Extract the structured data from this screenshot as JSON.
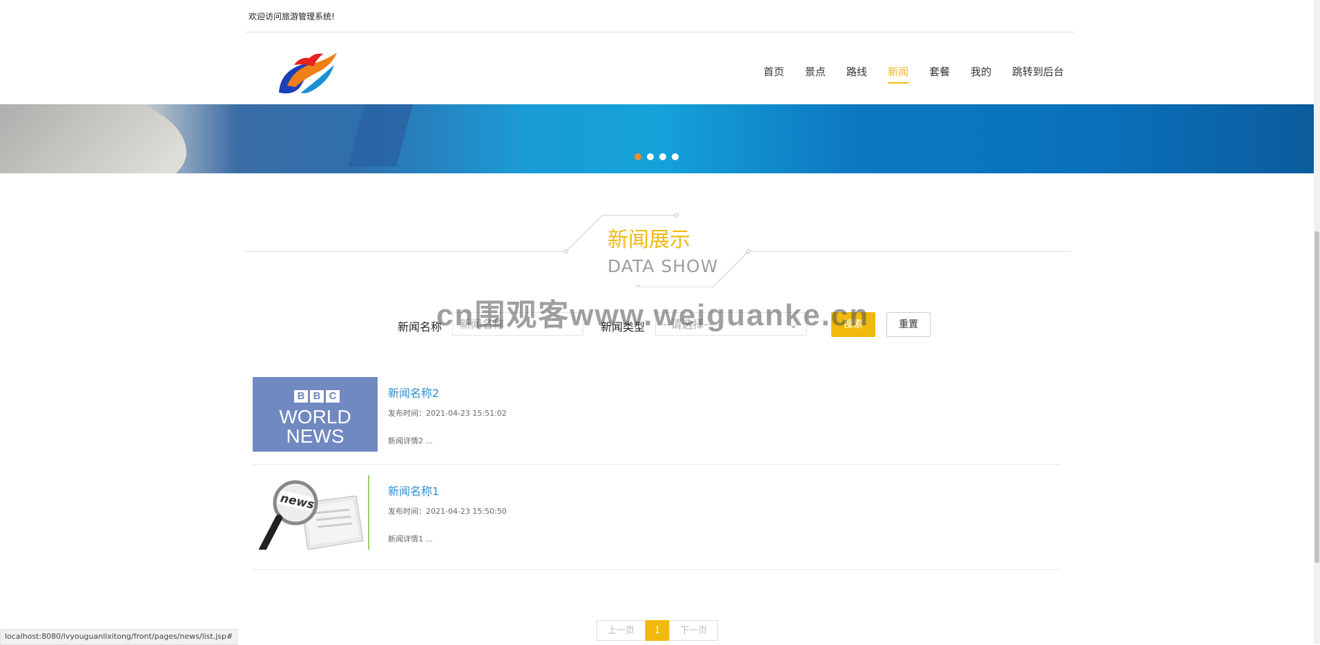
{
  "header": {
    "welcome": "欢迎访问旅游管理系统!",
    "nav": [
      "首页",
      "景点",
      "路线",
      "新闻",
      "套餐",
      "我的",
      "跳转到后台"
    ],
    "active_nav": "新闻"
  },
  "banner": {
    "slide_count": 4,
    "active_slide": 1
  },
  "section": {
    "title_zh": "新闻展示",
    "title_en": "DATA SHOW"
  },
  "search": {
    "name_label": "新闻名称",
    "name_placeholder": "新闻名称",
    "type_label": "新闻类型",
    "type_value": "--请选择--",
    "search_button": "搜索",
    "reset_button": "重置"
  },
  "news": [
    {
      "title": "新闻名称2",
      "time": "发布时间：2021-04-23 15:51:02",
      "desc": "新闻详情2 ...",
      "thumb": "bbc-world-news",
      "thumb_text": [
        "B",
        "B",
        "C",
        "WORLD",
        "NEWS"
      ]
    },
    {
      "title": "新闻名称1",
      "time": "发布时间：2021-04-23 15:50:50",
      "desc": "新闻详情1 ...",
      "thumb": "magnifier-newspaper",
      "thumb_text": [
        "news"
      ]
    }
  ],
  "pager": {
    "prev": "上一页",
    "current": "1",
    "next": "下一页"
  },
  "status_url": "localhost:8080/lvyouguanlixitong/front/pages/news/list.jsp#",
  "watermark": "cn围观客www.weiguanke.cn",
  "colors": {
    "accent": "#f0b90b",
    "link": "#2b8fd5",
    "active_dot": "#f28b30"
  }
}
